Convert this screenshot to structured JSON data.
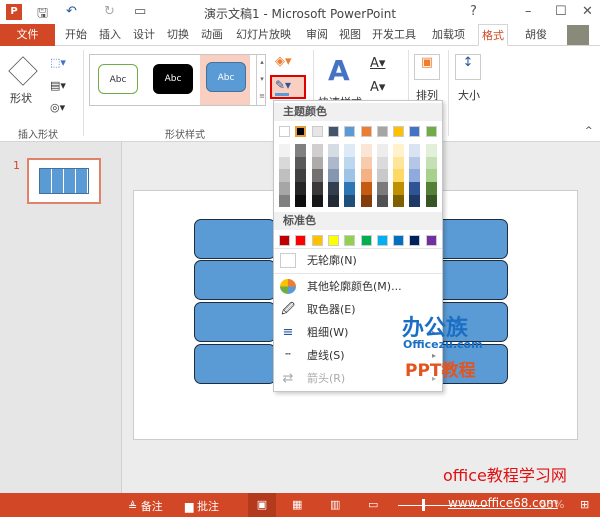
{
  "window": {
    "title": "演示文稿1 - Microsoft PowerPoint",
    "help": "?",
    "minimize": "–",
    "maximize": "☐",
    "close": "✕"
  },
  "quick_access": {
    "app_icon": "P",
    "save": "🖫",
    "undo": "↶",
    "redo": "↻",
    "present": "▭"
  },
  "tabs": [
    {
      "label": "文件"
    },
    {
      "label": "开始"
    },
    {
      "label": "插入"
    },
    {
      "label": "设计"
    },
    {
      "label": "切换"
    },
    {
      "label": "动画"
    },
    {
      "label": "幻灯片放映"
    },
    {
      "label": "审阅"
    },
    {
      "label": "视图"
    },
    {
      "label": "开发工具"
    },
    {
      "label": "加载项"
    },
    {
      "label": "格式"
    }
  ],
  "user": "胡俊",
  "ribbon": {
    "shape_label": "形状",
    "insert_shapes_group": "插入形状",
    "style_sample": "Abc",
    "shape_styles_group": "形状样式",
    "quick_styles": "快速样式",
    "arrange": "排列",
    "size": "大小"
  },
  "menu": {
    "theme_header": "主题颜色",
    "theme_colors": [
      "#ffffff",
      "#000000",
      "#e7e6e6",
      "#44546a",
      "#5b9bd5",
      "#ed7d31",
      "#a5a5a5",
      "#ffc000",
      "#4472c4",
      "#70ad47"
    ],
    "theme_shades": [
      [
        "#f2f2f2",
        "#d9d9d9",
        "#bfbfbf",
        "#a6a6a6",
        "#808080"
      ],
      [
        "#808080",
        "#595959",
        "#404040",
        "#262626",
        "#0d0d0d"
      ],
      [
        "#d0cece",
        "#aeabab",
        "#757070",
        "#3a3838",
        "#171616"
      ],
      [
        "#d6dce4",
        "#adb9ca",
        "#8496b0",
        "#333f4f",
        "#222a35"
      ],
      [
        "#deebf6",
        "#bdd7ee",
        "#9dc3e6",
        "#2e75b5",
        "#1f4e79"
      ],
      [
        "#fbe5d5",
        "#f7cbac",
        "#f4b183",
        "#c55a11",
        "#833c0b"
      ],
      [
        "#ededed",
        "#dbdbdb",
        "#c9c9c9",
        "#7b7b7b",
        "#525252"
      ],
      [
        "#fff2cc",
        "#fee599",
        "#ffd965",
        "#bf9000",
        "#7f6000"
      ],
      [
        "#dae3f3",
        "#b4c7e7",
        "#8faadc",
        "#2f5496",
        "#1f3864"
      ],
      [
        "#e2efd9",
        "#c5e0b3",
        "#a8d08d",
        "#538135",
        "#375623"
      ]
    ],
    "standard_header": "标准色",
    "standard_colors": [
      "#c00000",
      "#ff0000",
      "#ffc000",
      "#ffff00",
      "#92d050",
      "#00b050",
      "#00b0f0",
      "#0070c0",
      "#002060",
      "#7030a0"
    ],
    "items": [
      {
        "label": "无轮廓(N)"
      },
      {
        "label": "其他轮廓颜色(M)..."
      },
      {
        "label": "取色器(E)"
      },
      {
        "label": "粗细(W)"
      },
      {
        "label": "虚线(S)"
      },
      {
        "label": "箭头(R)"
      }
    ]
  },
  "slide_number": "1",
  "status": {
    "notes": "备注",
    "comments": "批注",
    "zoom": "55%"
  },
  "watermarks": {
    "logo_top": "办公族",
    "logo_url": "Officezu.com",
    "logo_bottom": "PPT教程",
    "site": "office教程学习网",
    "site_url": "www.office68.com"
  }
}
